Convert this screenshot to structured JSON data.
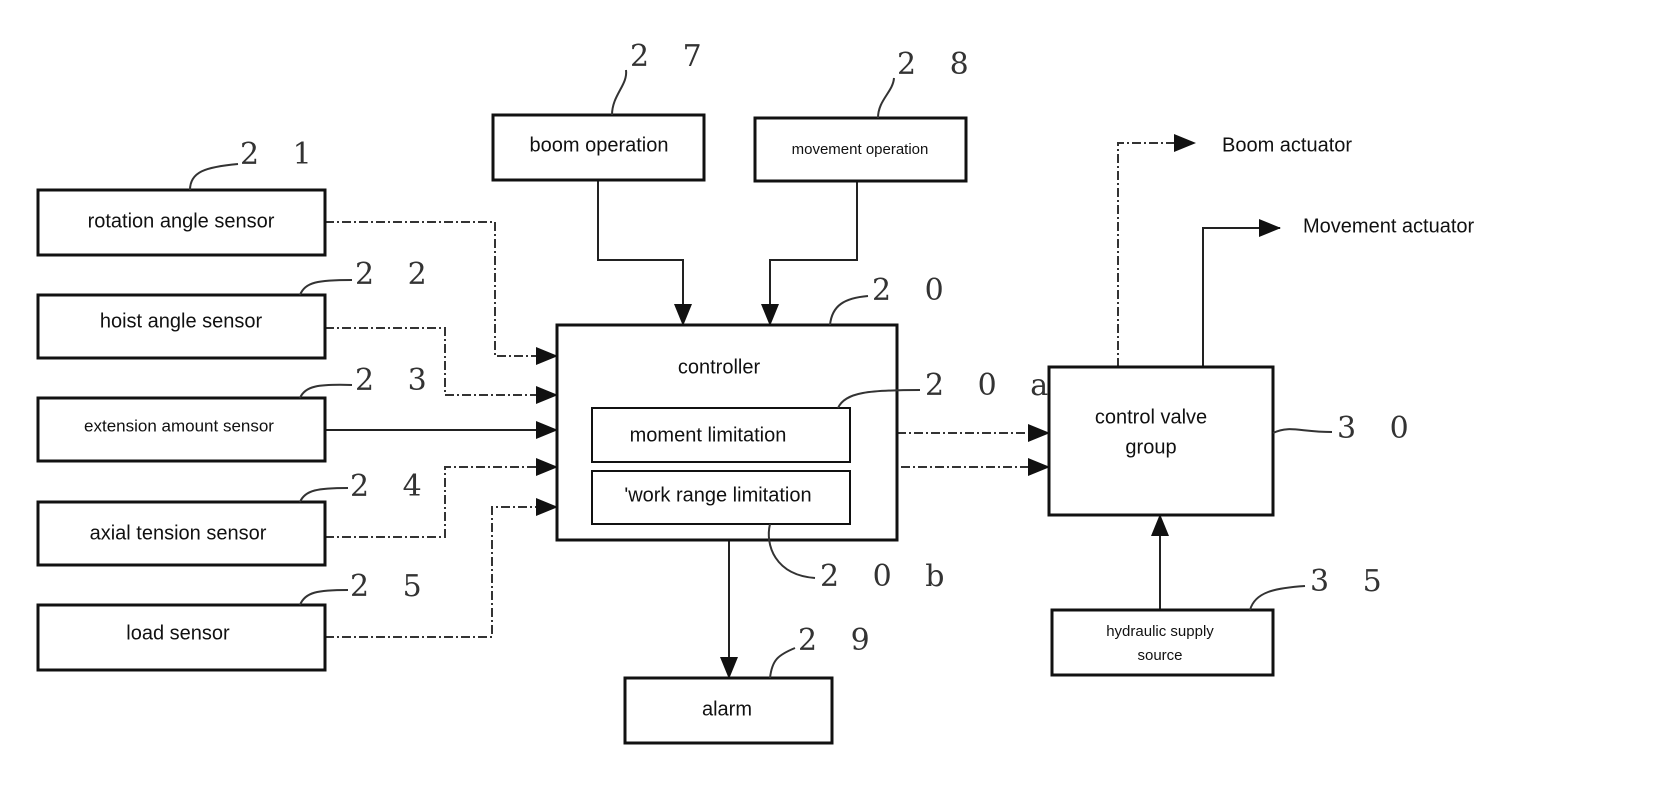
{
  "blocks": {
    "rotation": {
      "label": "rotation angle sensor",
      "ref": "2 1"
    },
    "hoist": {
      "label": "hoist angle sensor",
      "ref": "2 2"
    },
    "extension": {
      "label": "extension amount sensor",
      "ref": "2 3"
    },
    "axial": {
      "label": "axial tension sensor",
      "ref": "2 4"
    },
    "load": {
      "label": "load sensor",
      "ref": "2 5"
    },
    "boom_op": {
      "label": "boom operation",
      "ref": "2 7"
    },
    "move_op": {
      "label": "movement operation",
      "ref": "2 8"
    },
    "controller": {
      "label": "controller",
      "ref": "2 0"
    },
    "moment": {
      "label": "moment limitation",
      "ref": "2 0 a"
    },
    "work_range": {
      "label": "'work range limitation",
      "ref": "2 0 b"
    },
    "alarm": {
      "label": "alarm",
      "ref": "2 9"
    },
    "valve": {
      "label_line1": "control valve",
      "label_line2": "group",
      "ref": "3 0"
    },
    "hydraulic": {
      "label_line1": "hydraulic supply",
      "label_line2": "source",
      "ref": "3 5"
    }
  },
  "outputs": {
    "boom_actuator": "Boom actuator",
    "movement_actuator": "Movement actuator"
  }
}
